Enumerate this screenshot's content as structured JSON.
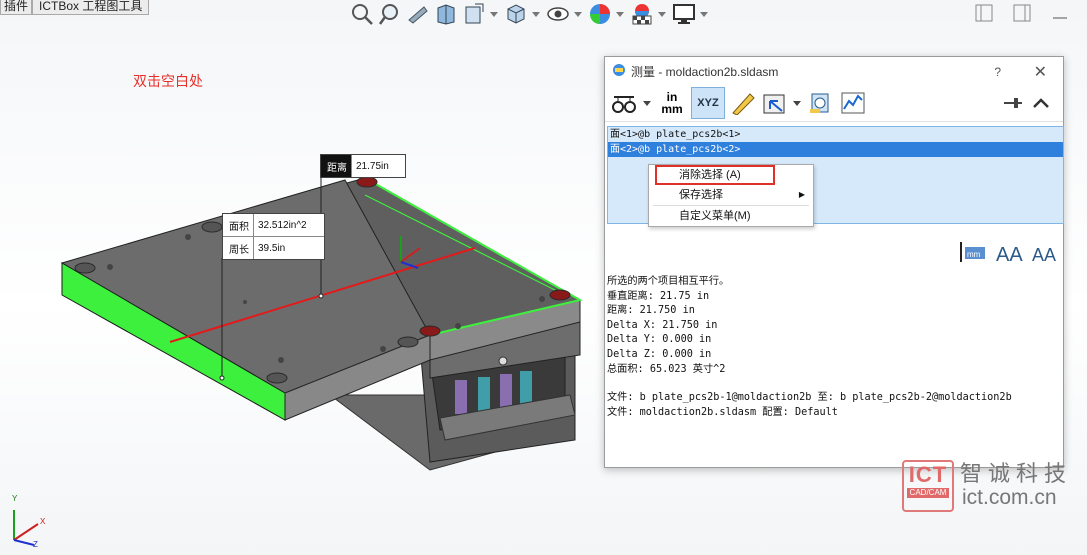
{
  "top_tabs": [
    "插件",
    "ICTBox 工程图工具"
  ],
  "hint_text": "双击空白处",
  "callouts": {
    "distance": {
      "label": "距离",
      "value": "21.75in"
    },
    "area": {
      "label": "面积",
      "value": "32.512in^2"
    },
    "perimeter": {
      "label": "周长",
      "value": "39.5in"
    }
  },
  "dialog": {
    "title": "测量 - moldaction2b.sldasm",
    "help": "?",
    "close": "✕",
    "tools": {
      "units_line1": "in",
      "units_line2": "mm",
      "xyz": "XYZ"
    },
    "selections": [
      "面<1>@b plate_pcs2b<1>",
      "面<2>@b plate_pcs2b<2>"
    ],
    "results": [
      "所选的两个项目相互平行。",
      "垂直距离: 21.75 in",
      "距离: 21.750 in",
      "Delta X: 21.750 in",
      "Delta Y: 0.000 in",
      "Delta Z: 0.000 in",
      "总面积: 65.023 英寸^2",
      "",
      "文件:  b plate_pcs2b-1@moldaction2b 至:  b plate_pcs2b-2@moldaction2b",
      "文件:  moldaction2b.sldasm 配置:  Default"
    ]
  },
  "context_menu": {
    "items": [
      "消除选择 (A)",
      "保存选择",
      "自定义菜单(M)"
    ]
  },
  "watermark": {
    "logo_top": "ICT",
    "logo_bottom": "CAD/CAM",
    "name": "智诚科技",
    "url": "ict.com.cn"
  },
  "triad": {
    "x": "X",
    "y": "Y",
    "z": "Z"
  },
  "colors": {
    "accent_red": "#e8302a",
    "selection_blue": "#2f7fdc",
    "face_green": "#3df03d"
  }
}
